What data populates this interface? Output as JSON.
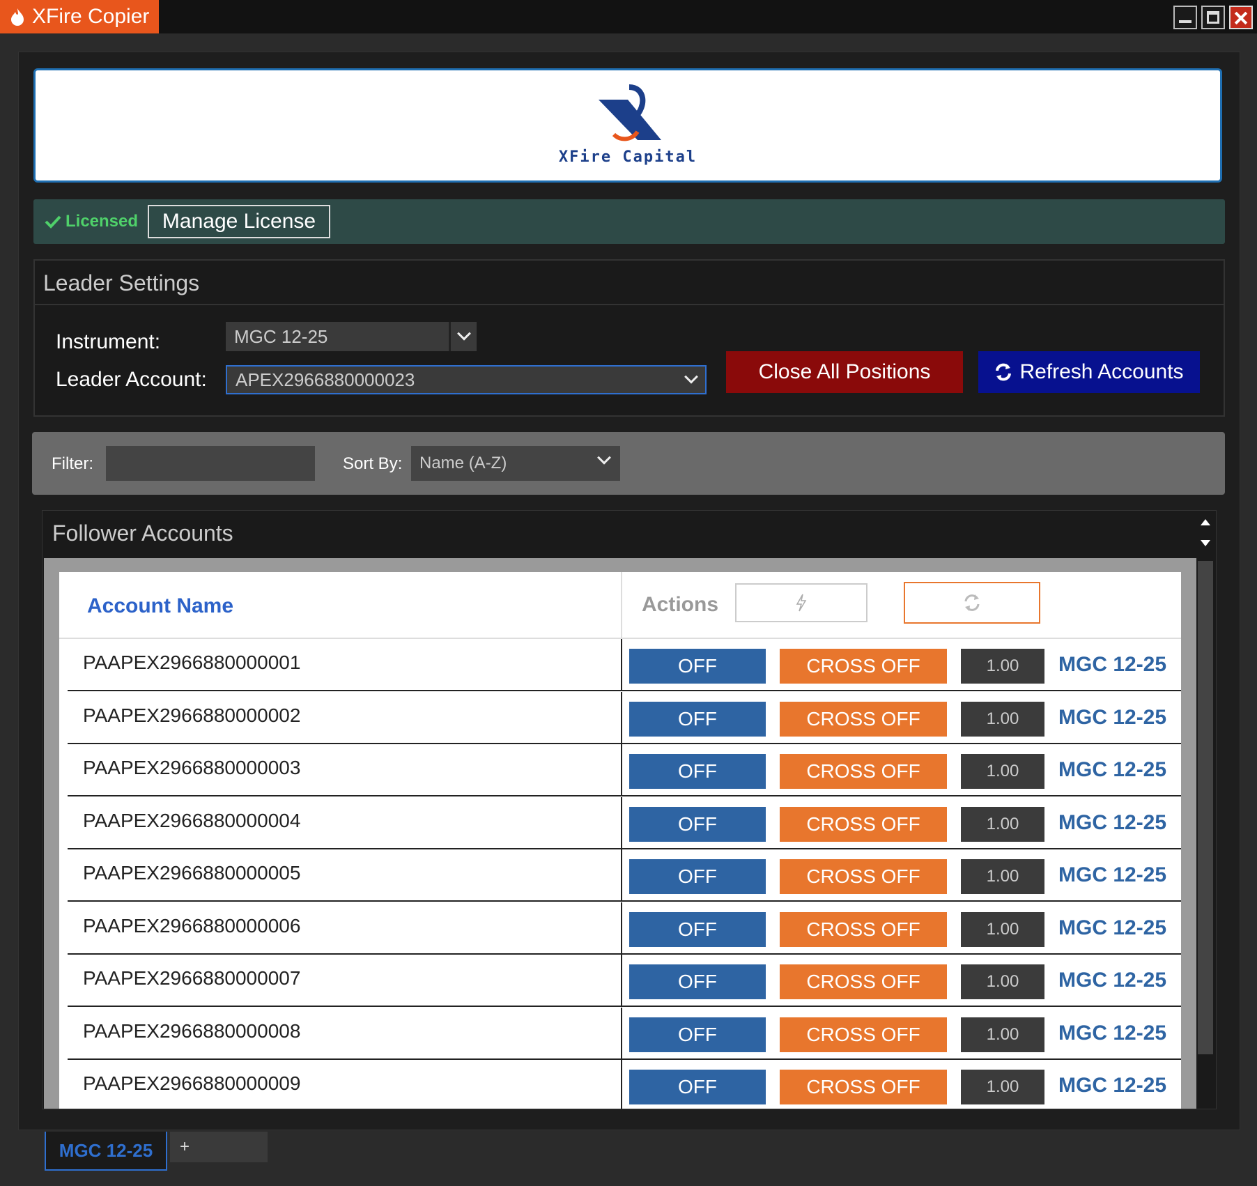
{
  "app": {
    "title": "XFire Copier"
  },
  "logo": {
    "text": "XFire Capital"
  },
  "license": {
    "status": "Licensed",
    "manage_label": "Manage License"
  },
  "leader": {
    "title": "Leader Settings",
    "instrument_label": "Instrument:",
    "instrument_value": "MGC 12-25",
    "account_label": "Leader Account:",
    "account_value": "APEX2966880000023",
    "close_all_label": "Close All Positions",
    "refresh_label": "Refresh Accounts"
  },
  "filter": {
    "filter_label": "Filter:",
    "filter_value": "",
    "sort_label": "Sort By:",
    "sort_value": "Name (A-Z)"
  },
  "followers": {
    "title": "Follower Accounts",
    "col_name": "Account Name",
    "col_actions": "Actions",
    "rows": [
      {
        "name": "PAAPEX2966880000001",
        "off": "OFF",
        "cross": "CROSS OFF",
        "qty": "1.00",
        "instrument": "MGC 12-25"
      },
      {
        "name": "PAAPEX2966880000002",
        "off": "OFF",
        "cross": "CROSS OFF",
        "qty": "1.00",
        "instrument": "MGC 12-25"
      },
      {
        "name": "PAAPEX2966880000003",
        "off": "OFF",
        "cross": "CROSS OFF",
        "qty": "1.00",
        "instrument": "MGC 12-25"
      },
      {
        "name": "PAAPEX2966880000004",
        "off": "OFF",
        "cross": "CROSS OFF",
        "qty": "1.00",
        "instrument": "MGC 12-25"
      },
      {
        "name": "PAAPEX2966880000005",
        "off": "OFF",
        "cross": "CROSS OFF",
        "qty": "1.00",
        "instrument": "MGC 12-25"
      },
      {
        "name": "PAAPEX2966880000006",
        "off": "OFF",
        "cross": "CROSS OFF",
        "qty": "1.00",
        "instrument": "MGC 12-25"
      },
      {
        "name": "PAAPEX2966880000007",
        "off": "OFF",
        "cross": "CROSS OFF",
        "qty": "1.00",
        "instrument": "MGC 12-25"
      },
      {
        "name": "PAAPEX2966880000008",
        "off": "OFF",
        "cross": "CROSS OFF",
        "qty": "1.00",
        "instrument": "MGC 12-25"
      },
      {
        "name": "PAAPEX2966880000009",
        "off": "OFF",
        "cross": "CROSS OFF",
        "qty": "1.00",
        "instrument": "MGC 12-25"
      }
    ]
  },
  "tabs": {
    "active": "MGC 12-25",
    "add": "+"
  },
  "colors": {
    "brand": "#e8561c",
    "accent_blue": "#2e64a3",
    "cross_orange": "#e8761d",
    "close_red": "#8a0a0a",
    "refresh_blue": "#07118f",
    "licensed_green": "#4fd16a"
  }
}
